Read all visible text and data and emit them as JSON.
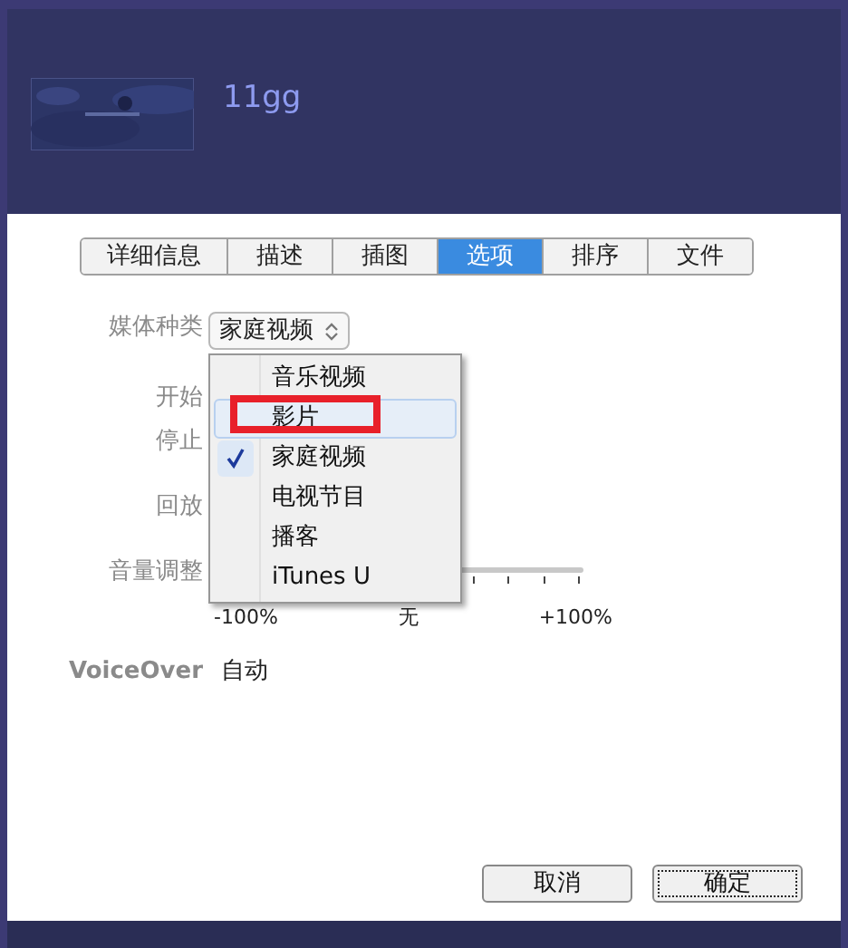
{
  "header": {
    "title": "11gg",
    "kind": "picture"
  },
  "tabs": [
    {
      "label": "详细信息",
      "selected": false
    },
    {
      "label": "描述",
      "selected": false
    },
    {
      "label": "插图",
      "selected": false
    },
    {
      "label": "选项",
      "selected": true
    },
    {
      "label": "排序",
      "selected": false
    },
    {
      "label": "文件",
      "selected": false
    }
  ],
  "media_kind": {
    "label": "媒体种类",
    "value": "家庭视频"
  },
  "menu": [
    {
      "label": "音乐视频",
      "checked": false,
      "highlighted": false,
      "annotated": false
    },
    {
      "label": "影片",
      "checked": false,
      "highlighted": true,
      "annotated": true
    },
    {
      "label": "家庭视频",
      "checked": true,
      "highlighted": false,
      "annotated": false
    },
    {
      "label": "电视节目",
      "checked": false,
      "highlighted": false,
      "annotated": false
    },
    {
      "label": "播客",
      "checked": false,
      "highlighted": false,
      "annotated": false
    },
    {
      "label": "iTunes U",
      "checked": false,
      "highlighted": false,
      "annotated": false
    }
  ],
  "start_label": "开始",
  "stop_label": "停止",
  "playback_label": "回放",
  "volume": {
    "label": "音量调整",
    "scale": [
      "-100%",
      "无",
      "+100%"
    ]
  },
  "voiceover": {
    "label": "VoiceOver",
    "value": "自动"
  },
  "buttons": [
    {
      "label": "取消",
      "default": false
    },
    {
      "label": "确定",
      "default": true
    }
  ]
}
